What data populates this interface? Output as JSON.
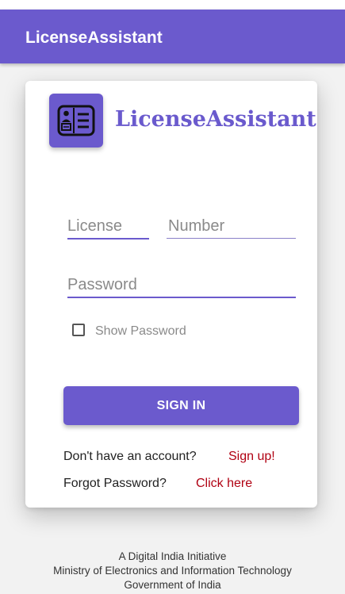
{
  "app_bar": {
    "title": "LicenseAssistant"
  },
  "brand": {
    "name": "LicenseAssistant",
    "logo_icon": "id-card-icon"
  },
  "form": {
    "license_placeholder_a": "License",
    "license_placeholder_b": "Number",
    "password_placeholder": "Password",
    "show_password_label": "Show Password",
    "show_password_checked": false,
    "sign_in_label": "SIGN IN"
  },
  "links": {
    "no_account_text": "Don't have an account?",
    "sign_up_label": "Sign up!",
    "forgot_text": "Forgot Password?",
    "click_here_label": "Click here"
  },
  "footer": {
    "line1": "A Digital India Initiative",
    "line2": "Ministry of Electronics and Information Technology",
    "line3": "Government of India"
  },
  "colors": {
    "primary": "#6b5acd",
    "link": "#b00012",
    "placeholder": "#8a8a8a"
  }
}
